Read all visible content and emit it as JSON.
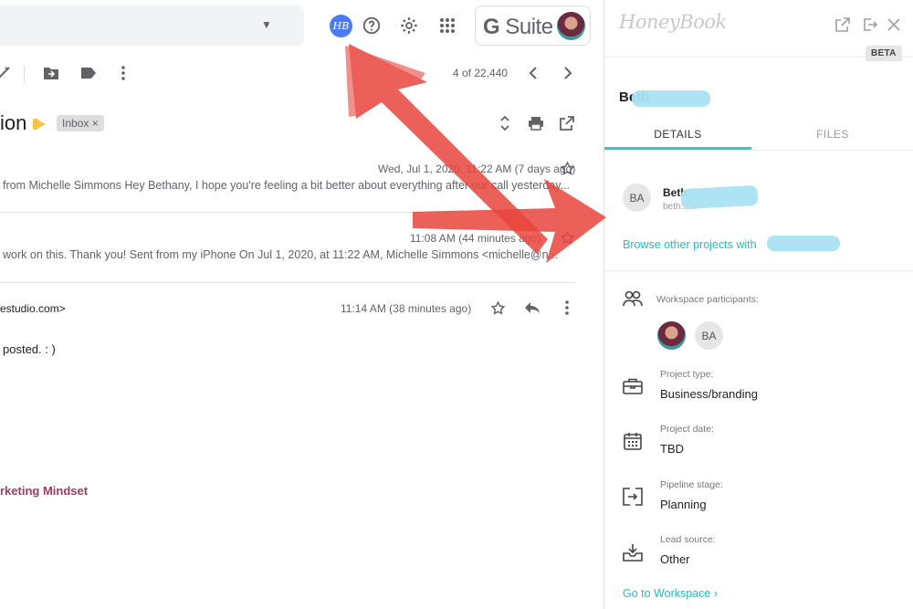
{
  "gmail": {
    "pager": "4 of 22,440",
    "subject_fragment": "ion",
    "inbox_chip": "Inbox ×",
    "messages": [
      {
        "date": "Wed, Jul 1, 2020, 11:22 AM (7 days ago)",
        "snippet": "from Michelle Simmons Hey Bethany, I hope you're feeling a bit better about everything after our call yesterday..."
      },
      {
        "date": "11:08 AM (44 minutes ago)",
        "snippet": "work on this. Thank you! Sent from my iPhone On Jul 1, 2020, at 11:22 AM, Michelle Simmons <michelle@n..."
      },
      {
        "date": "11:14 AM (38 minutes ago)",
        "sender_address": "estudio.com>",
        "body": "posted. : )",
        "signature": "rketing Mindset"
      }
    ],
    "gsuite_label": "Suite",
    "hb_badge": "HB"
  },
  "honeybook": {
    "logo": "HoneyBook",
    "beta": "BETA",
    "client_name": "Beth",
    "tabs": [
      "DETAILS",
      "FILES"
    ],
    "contact": {
      "initials": "BA",
      "name": "Beth",
      "email": "beth...m"
    },
    "browse_link": "Browse other projects with",
    "workspace_label": "Workspace participants:",
    "participant_initials": "BA",
    "rows": [
      {
        "label": "Project type:",
        "value": "Business/branding",
        "icon": "briefcase-icon"
      },
      {
        "label": "Project date:",
        "value": "TBD",
        "icon": "calendar-icon"
      },
      {
        "label": "Pipeline stage:",
        "value": "Planning",
        "icon": "pipeline-icon"
      },
      {
        "label": "Lead source:",
        "value": "Other",
        "icon": "inbox-tray-icon"
      }
    ],
    "goto_link": "Go to Workspace ›"
  },
  "colors": {
    "accent_teal": "#1fbdc4",
    "annotation_red": "#e8453c",
    "hb_badge_blue": "#4a7bf7",
    "signature_purple": "#9c3b67"
  }
}
